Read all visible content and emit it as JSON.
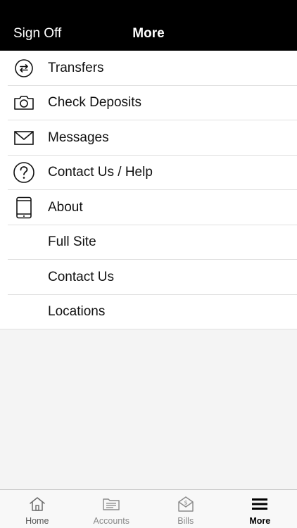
{
  "navbar": {
    "left_label": "Sign Off",
    "title": "More"
  },
  "menu": {
    "items": [
      {
        "label": "Transfers",
        "icon": "transfer-arrows-icon"
      },
      {
        "label": "Check Deposits",
        "icon": "camera-icon"
      },
      {
        "label": "Messages",
        "icon": "envelope-icon"
      },
      {
        "label": "Contact Us / Help",
        "icon": "question-circle-icon"
      },
      {
        "label": "About",
        "icon": "phone-device-icon"
      },
      {
        "label": "Full Site",
        "icon": ""
      },
      {
        "label": "Contact Us",
        "icon": ""
      },
      {
        "label": "Locations",
        "icon": ""
      }
    ]
  },
  "tabbar": {
    "tabs": [
      {
        "label": "Home",
        "icon": "house-icon"
      },
      {
        "label": "Accounts",
        "icon": "folder-icon"
      },
      {
        "label": "Bills",
        "icon": "bill-envelope-icon"
      },
      {
        "label": "More",
        "icon": "hamburger-menu-icon",
        "active": true
      }
    ]
  },
  "colors": {
    "header_bg": "#000000",
    "content_bg": "#f4f4f4",
    "active_tab": "#000000",
    "inactive_tab": "#8a8a8a"
  }
}
